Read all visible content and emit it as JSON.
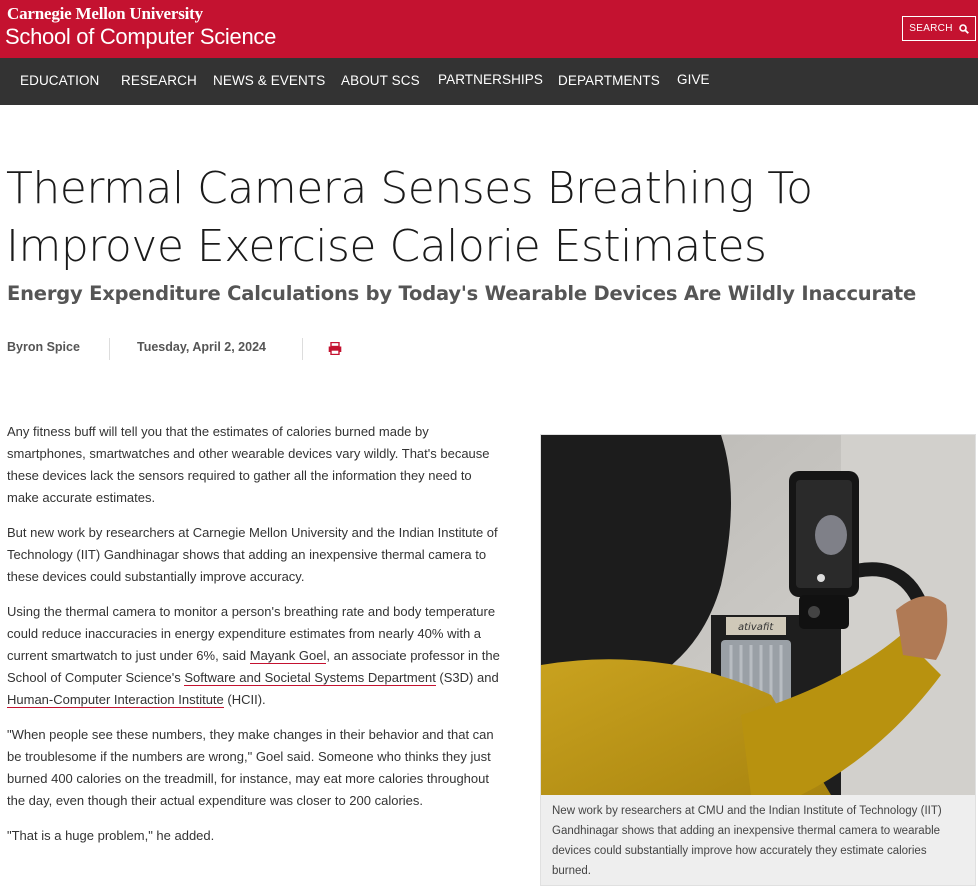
{
  "header": {
    "university": "Carnegie Mellon University",
    "school": "School of Computer Science",
    "search_label": "SEARCH",
    "brand_color": "#c41230"
  },
  "nav": {
    "items": [
      "EDUCATION",
      "RESEARCH",
      "NEWS & EVENTS",
      "ABOUT SCS",
      "PARTNERSHIPS",
      "DEPARTMENTS",
      "GIVE"
    ]
  },
  "article": {
    "title_line1": "Thermal Camera Senses Breathing To",
    "title_line2": "Improve Exercise Calorie Estimates",
    "subtitle": "Energy Expenditure Calculations by Today's Wearable Devices Are Wildly Inaccurate",
    "author": "Byron Spice",
    "date": "Tuesday, April 2, 2024",
    "print_icon": "print-icon",
    "paragraphs": {
      "p1": "Any fitness buff will tell you that the estimates of calories burned made by smartphones, smartwatches and other wearable devices vary wildly. That's because these devices lack the sensors required to gather all the information they need to make accurate estimates.",
      "p2": "But new work by researchers at Carnegie Mellon University and the Indian Institute of Technology (IIT) Gandhinagar shows that adding an inexpensive thermal camera to these devices could substantially improve accuracy.",
      "p3_a": "Using the thermal camera to monitor a person's breathing rate and body temperature could reduce inaccuracies in energy expenditure estimates from nearly 40% with a current smartwatch to just under 6%, said ",
      "p3_link1": "Mayank Goel",
      "p3_b": ", an associate professor in the School of Computer Science's ",
      "p3_link2": "Software and Societal Systems Department",
      "p3_c": " (S3D) and ",
      "p3_link3": "Human-Computer Interaction Institute",
      "p3_d": " (HCII).",
      "p4": "\"When people see these numbers, they make changes in their behavior and that can be troublesome if the numbers are wrong,\" Goel said. Someone who thinks they just burned 400 calories on the treadmill, for instance, may eat more calories throughout the day, even though their actual expenditure was closer to 200 calories.",
      "p5": "\"That is a huge problem,\" he added."
    },
    "figure": {
      "device_brand": "ativafit",
      "caption": "New work by researchers at CMU and the Indian Institute of Technology (IIT) Gandhinagar shows that adding an inexpensive thermal camera to wearable devices could substantially improve how accurately they estimate calories burned."
    }
  }
}
